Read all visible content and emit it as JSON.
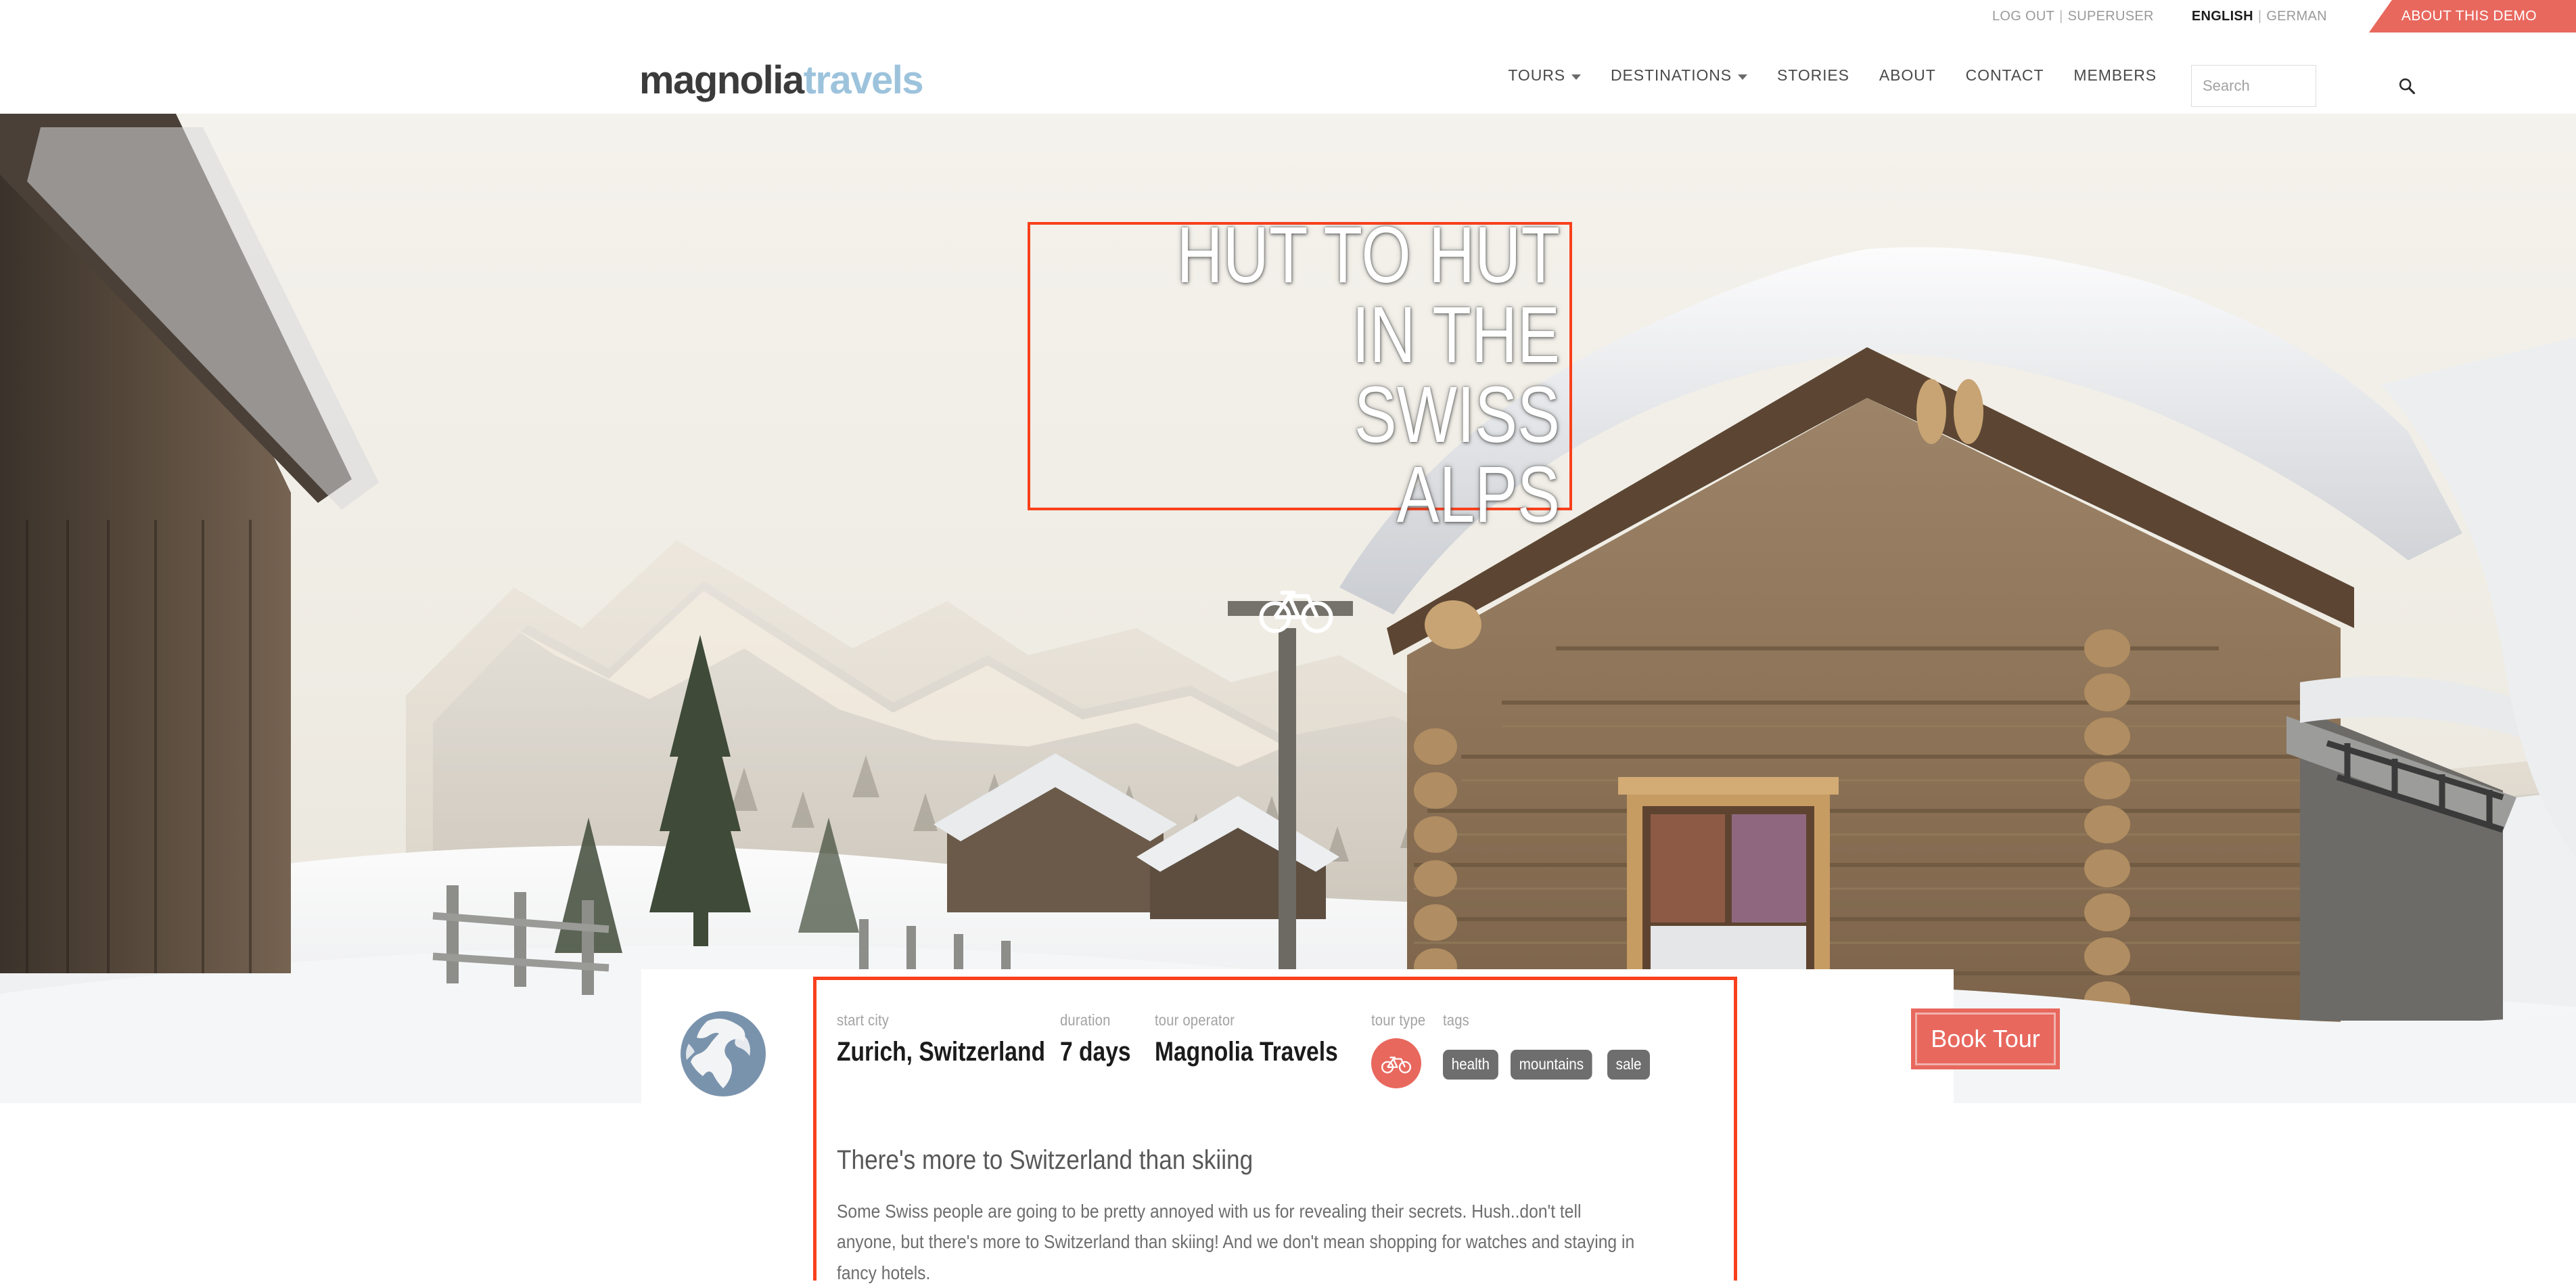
{
  "utility": {
    "logout_label": "LOG OUT",
    "separator": "|",
    "user_label": "SUPERUSER",
    "lang_primary": "ENGLISH",
    "lang_secondary": "GERMAN",
    "demo_tab": "ABOUT THIS DEMO"
  },
  "header": {
    "logo_first": "magnolia",
    "logo_second": "travels",
    "nav": [
      {
        "label": "TOURS",
        "has_caret": true
      },
      {
        "label": "DESTINATIONS",
        "has_caret": true
      },
      {
        "label": "STORIES",
        "has_caret": false
      },
      {
        "label": "ABOUT",
        "has_caret": false
      },
      {
        "label": "CONTACT",
        "has_caret": false
      },
      {
        "label": "MEMBERS",
        "has_caret": false
      }
    ],
    "search": {
      "placeholder": "Search",
      "value": "",
      "icon": "search-icon"
    }
  },
  "hero": {
    "title": "HUT TO HUT\nIN THE SWISS\nALPS",
    "overlay_icon": "bicycle-icon",
    "scene": "snow-covered swiss alpine village with wooden log cabin and mountains"
  },
  "card": {
    "globe_icon": "globe-icon",
    "meta": [
      {
        "label": "start city",
        "value": "Zurich, Switzerland"
      },
      {
        "label": "duration",
        "value": "7 days"
      },
      {
        "label": "tour operator",
        "value": "Magnolia Travels"
      }
    ],
    "tour_type": {
      "label": "tour type",
      "icon": "bicycle-icon"
    },
    "tags": {
      "label": "tags",
      "items": [
        "health",
        "mountains",
        "sale"
      ]
    },
    "description": {
      "title": "There's more to Switzerland than skiing",
      "body": "Some Swiss people are going to be pretty annoyed with us for revealing their secrets. Hush..don't tell anyone, but there's more to Switzerland than skiing! And we don't mean shopping for watches and staying in fancy hotels."
    },
    "book_button": "Book Tour"
  },
  "colors": {
    "accent": "#e8685e",
    "selection_outline": "#f9401c",
    "logo_blue": "#9dc3dc",
    "globe_blue": "#7a93ad",
    "tag_gray": "#6e6e6e"
  }
}
